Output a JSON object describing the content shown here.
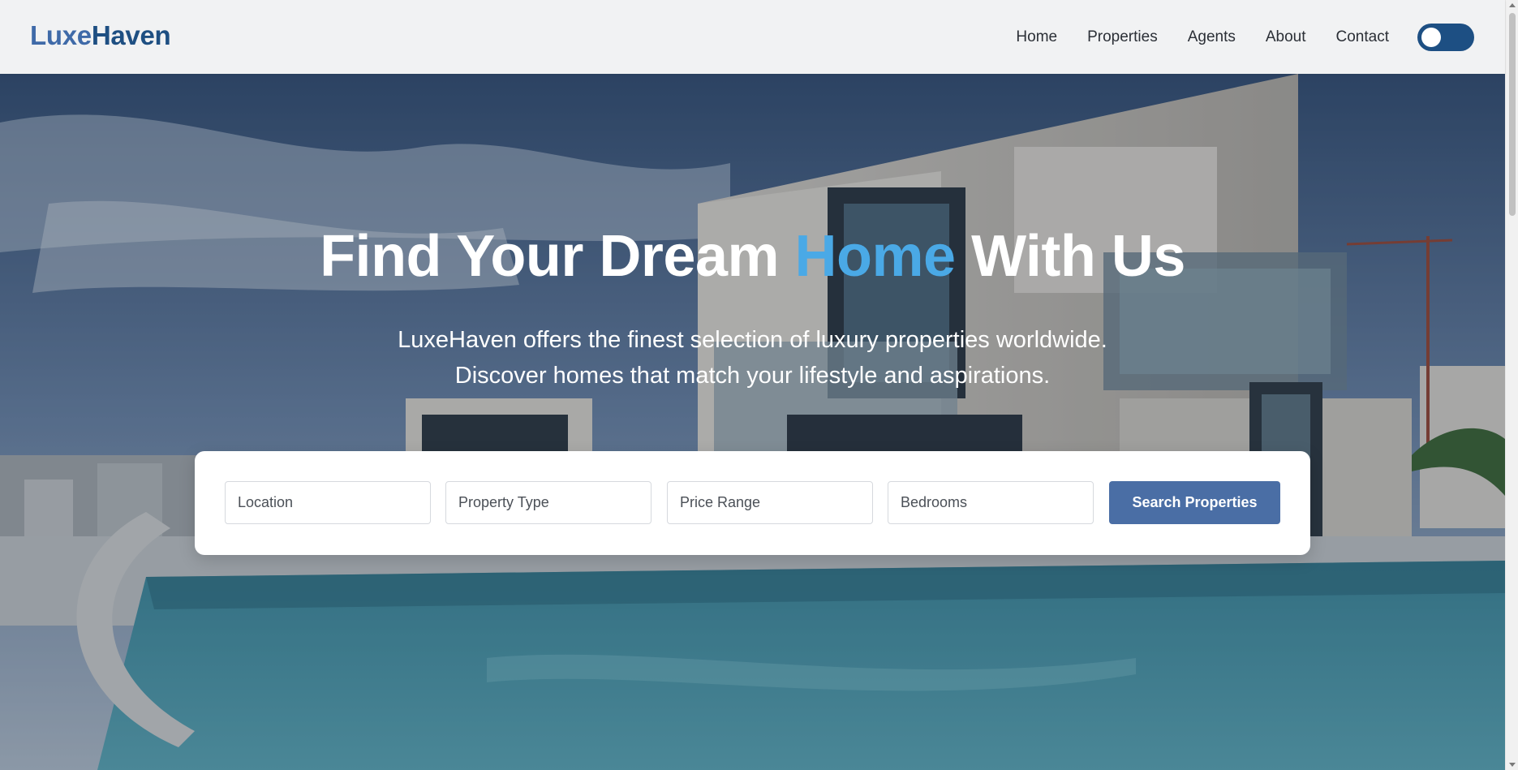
{
  "header": {
    "logo_part1": "Luxe",
    "logo_part2": "Haven",
    "nav": [
      {
        "label": "Home"
      },
      {
        "label": "Properties"
      },
      {
        "label": "Agents"
      },
      {
        "label": "About"
      },
      {
        "label": "Contact"
      }
    ],
    "theme_toggle_icon": "toggle-switch-icon"
  },
  "hero": {
    "title_before": "Find Your Dream ",
    "title_accent": "Home",
    "title_after": " With Us",
    "subtitle_line1": "LuxeHaven offers the finest selection of luxury properties worldwide.",
    "subtitle_line2": "Discover homes that match your lifestyle and aspirations."
  },
  "search": {
    "location_placeholder": "Location",
    "type_placeholder": "Property Type",
    "price_placeholder": "Price Range",
    "bedrooms_placeholder": "Bedrooms",
    "button_label": "Search Properties"
  },
  "colors": {
    "brand_dark": "#1e4f82",
    "brand_light": "#3f6aa8",
    "accent": "#4aa9e6",
    "button": "#4a6ea5"
  }
}
